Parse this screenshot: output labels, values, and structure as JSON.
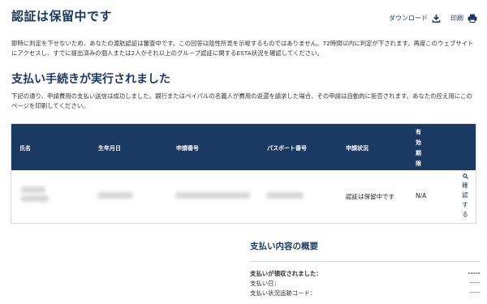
{
  "header": {
    "title": "認証は保留中です",
    "download_label": "ダウンロード",
    "print_label": "印刷"
  },
  "notice": "即時に判定を下せないため、あなたの渡航認証は審査中です。この回答は陰性所見を示唆するものではありません。72時間以内に判定が下されます。再度このウェブサイトにアクセスし、すでに提出済みの個人または2人かそれ以上のグループ認証に関するESTA状況を確認してください。",
  "payment": {
    "title": "支払い手続きが実行されました",
    "description": "下記の通り、申請費用の支払い送信は成功しました。銀行またはペイパルの名義人が費用の返還を請求した場合、その申請は自動的に拒否されます。あなたの控え用にこのページを印刷してください。"
  },
  "table": {
    "headers": {
      "name": "氏名",
      "birthdate": "生年月日",
      "application_number": "申請番号",
      "passport_number": "パスポート番号",
      "status": "申請状況",
      "valid_period": "有効期限"
    },
    "row": {
      "status": "認証は保留中です",
      "valid_period": "N/A",
      "action_label": "確認する"
    }
  },
  "summary": {
    "title": "支払い内容の概要",
    "rows": [
      {
        "label": "支払いが領収されました：",
        "value": "-----"
      },
      {
        "label": "支払い日：",
        "value": "-----"
      },
      {
        "label": "支払い状況追跡コード：",
        "value": "-----"
      }
    ]
  },
  "colors": {
    "brand_navy": "#1b3a63"
  },
  "icons": {
    "download": "download-icon",
    "print": "printer-icon",
    "search": "search-icon"
  }
}
